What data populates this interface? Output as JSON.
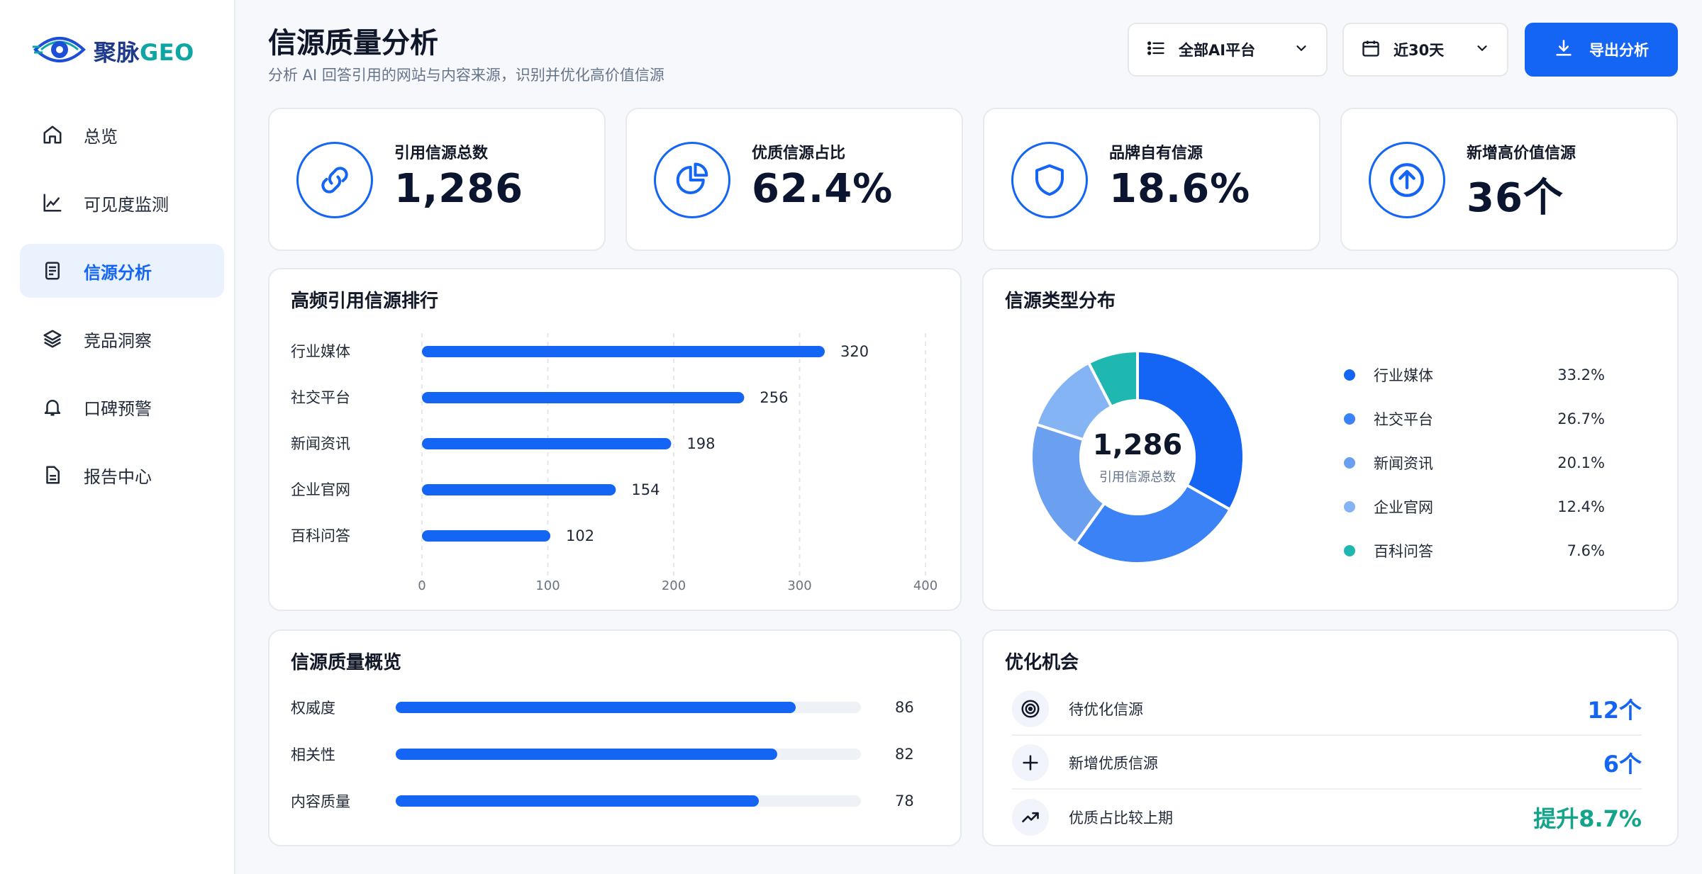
{
  "app": {
    "logo_text": "聚脉",
    "logo_suffix": "GEO"
  },
  "sidebar": {
    "items": [
      {
        "label": "总览",
        "icon": "home-icon",
        "active": false
      },
      {
        "label": "可见度监测",
        "icon": "line-chart-icon",
        "active": false
      },
      {
        "label": "信源分析",
        "icon": "document-icon",
        "active": true
      },
      {
        "label": "竞品洞察",
        "icon": "layers-icon",
        "active": false
      },
      {
        "label": "口碑预警",
        "icon": "bell-icon",
        "active": false
      },
      {
        "label": "报告中心",
        "icon": "report-file-icon",
        "active": false
      }
    ]
  },
  "header": {
    "title": "信源质量分析",
    "subtitle": "分析 AI 回答引用的网站与内容来源，识别并优化高价值信源",
    "platform_filter": "全部AI平台",
    "date_filter": "近30天",
    "export_label": "导出分析"
  },
  "stats": [
    {
      "label": "引用信源总数",
      "value": "1,286",
      "icon": "link-icon"
    },
    {
      "label": "优质信源占比",
      "value": "62.4%",
      "icon": "pie-chart-icon"
    },
    {
      "label": "品牌自有信源",
      "value": "18.6%",
      "icon": "shield-icon"
    },
    {
      "label": "新增高价值信源",
      "value": "36个",
      "icon": "arrow-up-circle-icon"
    }
  ],
  "ranking": {
    "title": "高频引用信源排行"
  },
  "type_dist": {
    "title": "信源类型分布",
    "center_value": "1,286",
    "center_label": "引用信源总数"
  },
  "chart_data": [
    {
      "type": "bar",
      "orientation": "horizontal",
      "title": "高频引用信源排行",
      "categories": [
        "行业媒体",
        "社交平台",
        "新闻资讯",
        "企业官网",
        "百科问答"
      ],
      "values": [
        320,
        256,
        198,
        154,
        102
      ],
      "xlim": [
        0,
        400
      ],
      "xticks": [
        "0",
        "100",
        "200",
        "300",
        "400"
      ],
      "grid": "vertical-dashed",
      "bar_color": "#1565f5"
    },
    {
      "type": "pie",
      "variant": "donut",
      "title": "信源类型分布",
      "categories": [
        "行业媒体",
        "社交平台",
        "新闻资讯",
        "企业官网",
        "百科问答"
      ],
      "values": [
        33.2,
        26.7,
        20.1,
        12.4,
        7.6
      ],
      "labels": [
        "33.2%",
        "26.7%",
        "20.1%",
        "12.4%",
        "7.6%"
      ],
      "colors": [
        "#1565f5",
        "#3b82f6",
        "#6b9ff0",
        "#85b4f5",
        "#1fb8b0"
      ],
      "legend": "right"
    }
  ],
  "quality": {
    "title": "信源质量概览",
    "max": 100,
    "items": [
      {
        "label": "权威度",
        "value": 86
      },
      {
        "label": "相关性",
        "value": 82
      },
      {
        "label": "内容质量",
        "value": 78
      }
    ]
  },
  "opportunities": {
    "title": "优化机会",
    "items": [
      {
        "label": "待优化信源",
        "value": "12个",
        "icon": "target-icon",
        "color": "#1565f5"
      },
      {
        "label": "新增优质信源",
        "value": "6个",
        "icon": "plus-icon",
        "color": "#1565f5"
      },
      {
        "label": "优质占比较上期",
        "value": "提升8.7%",
        "icon": "trending-up-icon",
        "color": "#14a38b"
      }
    ]
  }
}
